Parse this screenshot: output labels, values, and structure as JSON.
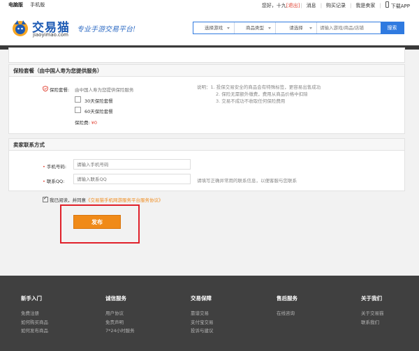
{
  "topbar": {
    "left": [
      "电脑版",
      "手机版"
    ],
    "greeting": "您好，十九",
    "logout": "[退出]",
    "links": [
      "消息",
      "购买记录",
      "我是卖家"
    ],
    "app": "下载APP"
  },
  "header": {
    "logo_name": "交易猫",
    "logo_url": "jiaoyimao.com",
    "slogan": "专业手游交易平台!",
    "search": {
      "game_select": "选择游戏",
      "type_select": "商品类型",
      "other_select": "请选择",
      "placeholder": "请输入游戏/商品/店铺",
      "button": "搜索"
    }
  },
  "insurance": {
    "title": "保险套餐（由中国人寿为您提供服务）",
    "label": "保险套餐:",
    "provider_text": "由中国人寿为您提供保险服务",
    "options": [
      "30天保险套餐",
      "60天保险套餐"
    ],
    "fee_label": "保险费:",
    "fee_value": "¥0",
    "notes": [
      "说明：1. 投保交易安全的商品会有特殊标签，更容易出售成功",
      "2. 保险无需额外缴费，费用从商品价格中扣除",
      "3. 交易不成功不收取任何保险费用"
    ]
  },
  "contact": {
    "title": "卖家联系方式",
    "phone_label": "手机号码:",
    "phone_placeholder": "请输入手机号码",
    "qq_label": "联系QQ:",
    "qq_placeholder": "请输入联系QQ",
    "qq_note": "请填写正确并常用的联系信息，以便客服与您联系"
  },
  "agreement": {
    "text": "我已阅读，并同意",
    "link": "《交易猫手机网游服务平台服务协议》"
  },
  "publish_button": "发布",
  "footer": {
    "columns": [
      {
        "title": "新手入门",
        "items": [
          "免费注册",
          "如何购买商品",
          "如何发布商品"
        ]
      },
      {
        "title": "诚信服务",
        "items": [
          "用户协议",
          "免责声明",
          "7*24小时服务"
        ]
      },
      {
        "title": "交易保障",
        "items": [
          "靠谱交易",
          "支付宝交易",
          "投诉与建议"
        ]
      },
      {
        "title": "售后服务",
        "items": [
          "在线咨询"
        ]
      },
      {
        "title": "关于我们",
        "items": [
          "关于交易猫",
          "联系我们"
        ]
      }
    ]
  },
  "colors": {
    "brand_blue": "#2f7ae0",
    "accent_orange": "#f08a18",
    "highlight_red": "#e0202a",
    "footer_bg": "#404040"
  }
}
